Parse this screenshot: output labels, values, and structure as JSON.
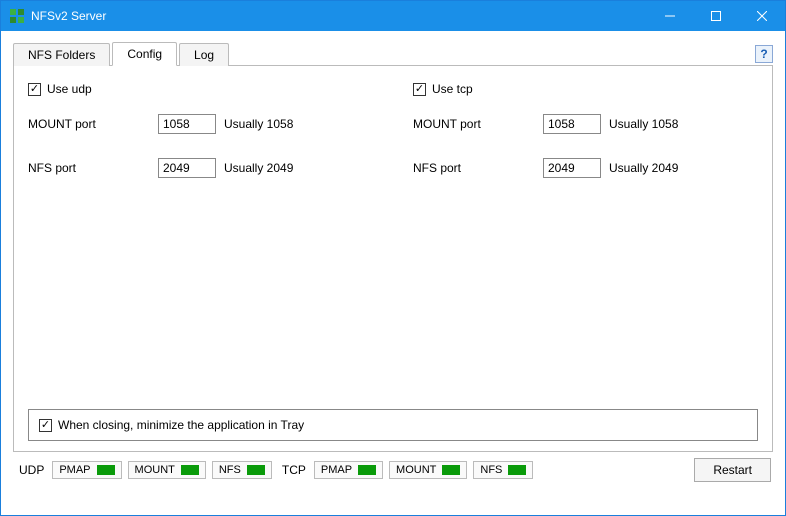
{
  "window": {
    "title": "NFSv2 Server"
  },
  "tabs": {
    "items": [
      "NFS Folders",
      "Config",
      "Log"
    ],
    "active": 1,
    "help": "?"
  },
  "config": {
    "udp": {
      "checkbox_label": "Use udp",
      "checked": true,
      "mount": {
        "label": "MOUNT port",
        "value": "1058",
        "hint": "Usually 1058"
      },
      "nfs": {
        "label": "NFS port",
        "value": "2049",
        "hint": "Usually 2049"
      }
    },
    "tcp": {
      "checkbox_label": "Use tcp",
      "checked": true,
      "mount": {
        "label": "MOUNT port",
        "value": "1058",
        "hint": "Usually 1058"
      },
      "nfs": {
        "label": "NFS port",
        "value": "2049",
        "hint": "Usually 2049"
      }
    },
    "tray": {
      "label": "When closing, minimize the application in Tray",
      "checked": true
    }
  },
  "status": {
    "udp_label": "UDP",
    "tcp_label": "TCP",
    "indicators": {
      "pmap": "PMAP",
      "mount": "MOUNT",
      "nfs": "NFS"
    },
    "restart_label": "Restart"
  }
}
